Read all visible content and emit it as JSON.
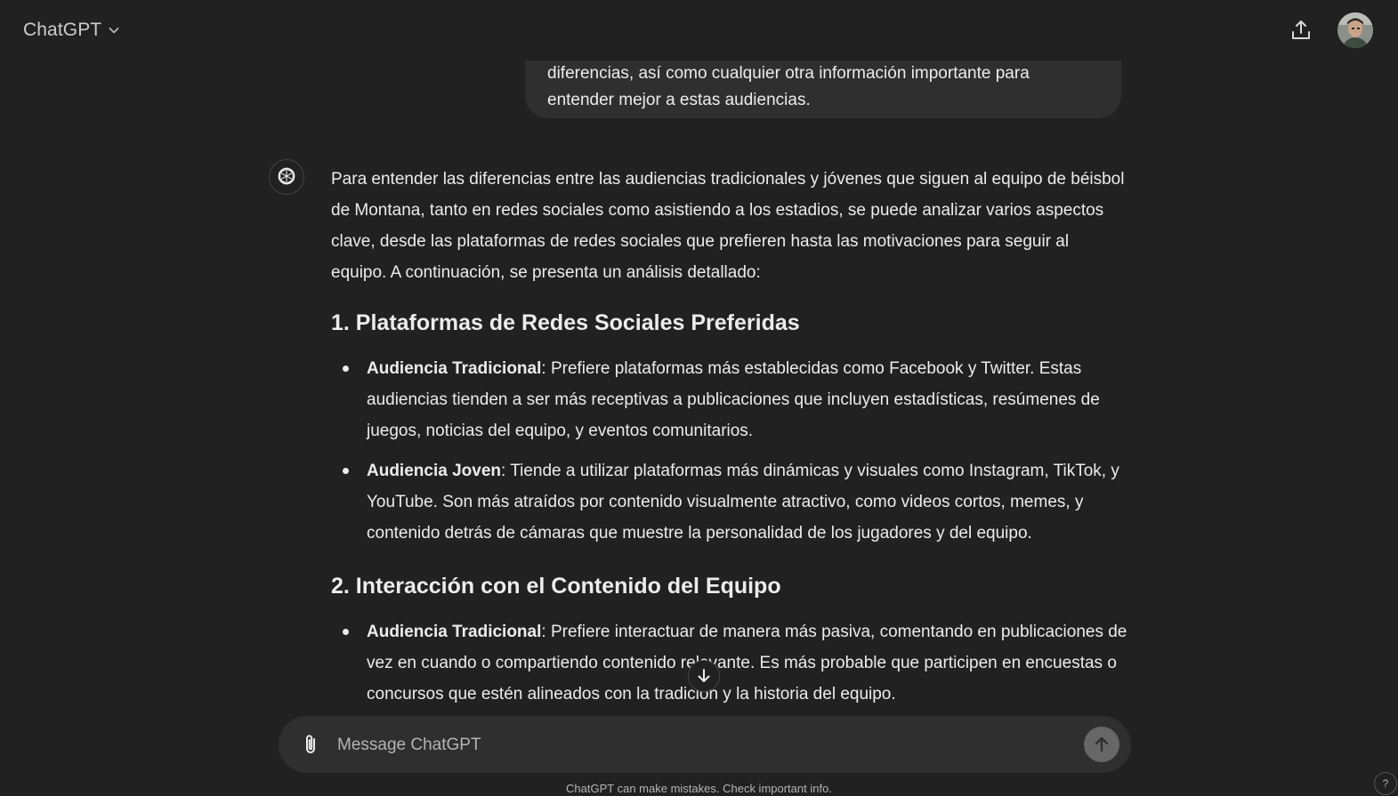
{
  "header": {
    "model_name": "ChatGPT",
    "icons": {
      "model_menu": "chevron-down-icon",
      "share": "share-icon",
      "avatar": "user-avatar"
    }
  },
  "user_message": {
    "lines": [
      "diferencias, así como cualquier otra información importante para",
      "entender mejor a estas audiencias."
    ]
  },
  "assistant_message": {
    "intro": "Para entender las diferencias entre las audiencias tradicionales y jóvenes que siguen al equipo de béisbol de Montana, tanto en redes sociales como asistiendo a los estadios, se puede analizar varios aspectos clave, desde las plataformas de redes sociales que prefieren hasta las motivaciones para seguir al equipo. A continuación, se presenta un análisis detallado:",
    "sections": [
      {
        "heading": "1. Plataformas de Redes Sociales Preferidas",
        "items": [
          {
            "label": "Audiencia Tradicional",
            "text": ": Prefiere plataformas más establecidas como Facebook y Twitter. Estas audiencias tienden a ser más receptivas a publicaciones que incluyen estadísticas, resúmenes de juegos, noticias del equipo, y eventos comunitarios."
          },
          {
            "label": "Audiencia Joven",
            "text": ": Tiende a utilizar plataformas más dinámicas y visuales como Instagram, TikTok, y YouTube. Son más atraídos por contenido visualmente atractivo, como videos cortos, memes, y contenido detrás de cámaras que muestre la personalidad de los jugadores y del equipo."
          }
        ]
      },
      {
        "heading": "2. Interacción con el Contenido del Equipo",
        "items": [
          {
            "label": "Audiencia Tradicional",
            "text": ": Prefiere interactuar de manera más pasiva, comentando en publicaciones de vez en cuando o compartiendo contenido relevante. Es más probable que participen en encuestas o concursos que estén alineados con la tradición y la historia del equipo."
          }
        ]
      }
    ]
  },
  "composer": {
    "placeholder": "Message ChatGPT",
    "value": ""
  },
  "footer": {
    "disclaimer": "ChatGPT can make mistakes. Check important info.",
    "help_label": "?"
  },
  "colors": {
    "background": "#212121",
    "bubble": "#2f2f2f",
    "text": "#ececec",
    "muted": "#b4b4b4",
    "send_disabled": "#676767"
  }
}
